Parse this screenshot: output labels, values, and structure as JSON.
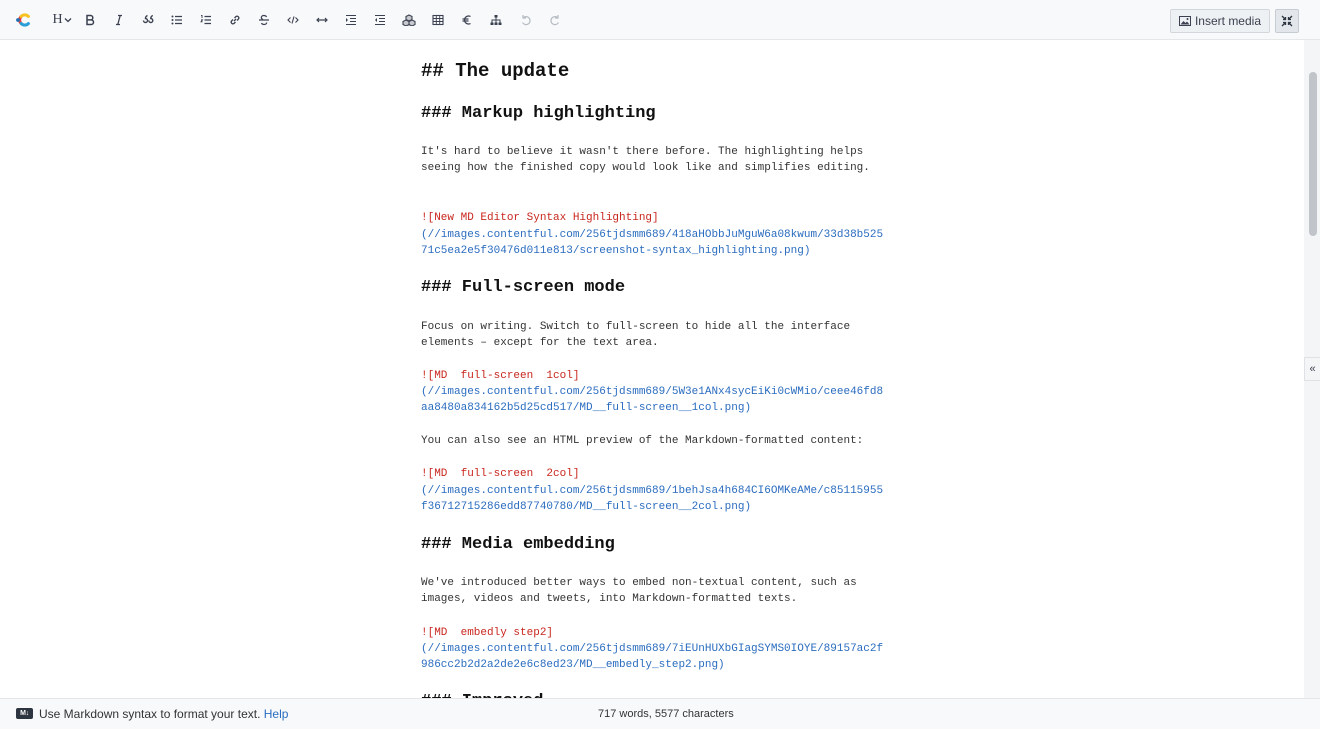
{
  "toolbar": {
    "heading_label": "H",
    "insert_media_label": "Insert media"
  },
  "document": {
    "lines": [
      {
        "type": "h2",
        "text": "## The update"
      },
      {
        "type": "h3",
        "text": "### Markup highlighting"
      },
      {
        "type": "p",
        "text": "It's hard to believe it wasn't there before. The highlighting helps"
      },
      {
        "type": "p",
        "text": "seeing how the finished copy would look like and simplifies editing."
      },
      {
        "type": "alt",
        "text": "![New MD Editor Syntax Highlighting]"
      },
      {
        "type": "url",
        "text": "(//images.contentful.com/256tjdsmm689/418aHObbJuMguW6a08kwum/33d38b525"
      },
      {
        "type": "url",
        "text": "71c5ea2e5f30476d011e813/screenshot-syntax_highlighting.png)"
      },
      {
        "type": "h3",
        "text": "### Full-screen mode"
      },
      {
        "type": "p",
        "text": "Focus on writing. Switch to full-screen to hide all the interface"
      },
      {
        "type": "p",
        "text": "elements – except for the text area."
      },
      {
        "type": "alt",
        "text": "![MD  full-screen  1col]"
      },
      {
        "type": "url",
        "text": "(//images.contentful.com/256tjdsmm689/5W3e1ANx4sycEiKi0cWMio/ceee46fd8"
      },
      {
        "type": "url",
        "text": "aa8480a834162b5d25cd517/MD__full-screen__1col.png)"
      },
      {
        "type": "p",
        "text": "You can also see an HTML preview of the Markdown-formatted content:"
      },
      {
        "type": "alt",
        "text": "![MD  full-screen  2col]"
      },
      {
        "type": "url",
        "text": "(//images.contentful.com/256tjdsmm689/1behJsa4h684CI6OMKeAMe/c85115955"
      },
      {
        "type": "url",
        "text": "f36712715286edd87740780/MD__full-screen__2col.png)"
      },
      {
        "type": "h3",
        "text": "### Media embedding"
      },
      {
        "type": "p",
        "text": "We've introduced better ways to embed non-textual content, such as"
      },
      {
        "type": "p",
        "text": "images, videos and tweets, into Markdown-formatted texts."
      },
      {
        "type": "alt",
        "text": "![MD  embedly step2]"
      },
      {
        "type": "url",
        "text": "(//images.contentful.com/256tjdsmm689/7iEUnHUXbGIagSYMS0IOYE/89157ac2f"
      },
      {
        "type": "url",
        "text": "986cc2b2d2a2de2e6c8ed23/MD__embedly_step2.png)"
      },
      {
        "type": "h3",
        "text": "### Improved..."
      }
    ]
  },
  "statusbar": {
    "md_badge": "M↓",
    "hint_text": "Use Markdown syntax to format your text.",
    "help_link": "Help",
    "counts": "717 words, 5577 characters"
  },
  "colors": {
    "toolbar_bg": "#f7f9fa",
    "link": "#2a6cbf",
    "image_alt": "#c8261d",
    "heading": "#111111"
  }
}
